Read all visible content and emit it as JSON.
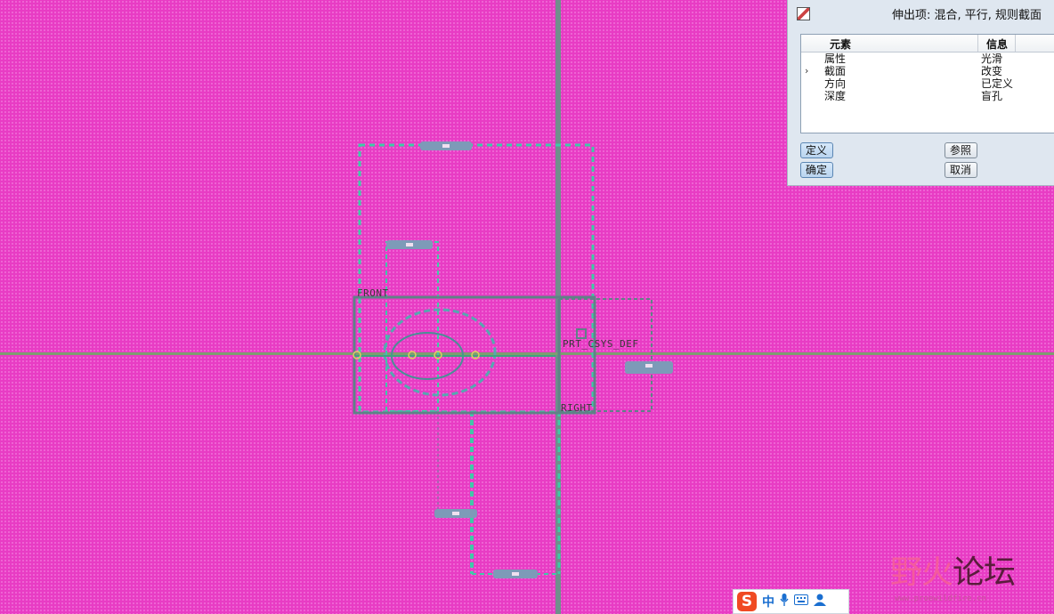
{
  "dialog": {
    "title": "伸出项: 混合, 平行, 规则截面",
    "columns": [
      "元素",
      "信息"
    ],
    "rows": [
      {
        "element": "属性",
        "info": "光滑",
        "current": false
      },
      {
        "element": "截面",
        "info": "改变",
        "current": true
      },
      {
        "element": "方向",
        "info": "已定义",
        "current": false
      },
      {
        "element": "深度",
        "info": "盲孔",
        "current": false
      }
    ],
    "buttons": {
      "define": "定义",
      "reference": "参照",
      "ok": "确定",
      "cancel": "取消"
    }
  },
  "viewport": {
    "labels": {
      "front": "FRONT",
      "csys": "PRT_CSYS_DEF",
      "right": "RIGHT"
    },
    "colors": {
      "background": "#e83cc4",
      "datum_axis": "#6f8f8c",
      "sketch": "#3fc9a8",
      "tag": "#7d9ab8"
    }
  },
  "ime": {
    "logo": "S",
    "mode": "中",
    "icons": [
      "mic-icon",
      "keyboard-icon",
      "user-icon"
    ]
  },
  "watermark": {
    "text_a": "野火",
    "text_b": "论坛",
    "url": "www.proewildfire.cn"
  }
}
